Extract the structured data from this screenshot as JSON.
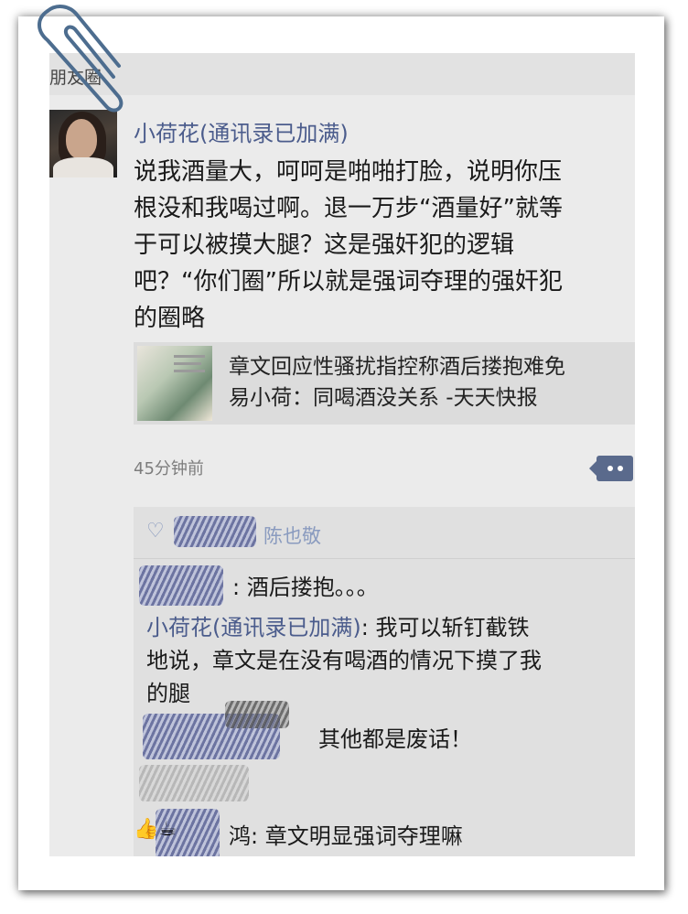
{
  "header": {
    "title": "朋友圈"
  },
  "post": {
    "author": "小荷花(通讯录已加满)",
    "text_lines": [
      "说我酒量大，呵呵是啪啪打脸，说明你压",
      "根没和我喝过啊。退一万步“酒量好”就等",
      "于可以被摸大腿？这是强奸犯的逻辑",
      "吧？“你们圈”所以就是强词夺理的强奸犯",
      "的圈略"
    ],
    "link": {
      "title_lines": [
        "章文回应性骚扰指控称酒后搂抱难免",
        "易小荷：同喝酒没关系 -天天快报"
      ]
    },
    "timestamp": "45分钟前"
  },
  "likes": {
    "names": "陈也敬"
  },
  "comments": [
    {
      "lines": [
        ": 酒后搂抱。。。"
      ]
    },
    {
      "name": "小荷花(通讯录已加满)",
      "lines": [
        ": 我可以斩钉截铁",
        "地说，章文是在没有喝酒的情况下摸了我",
        "的腿"
      ]
    },
    {
      "lines": [
        "其他都是废话！"
      ]
    },
    {
      "lines": [
        "鸿: 章文明显强词夺理嘛"
      ]
    }
  ],
  "reaction": {
    "emoji": "👍☕"
  }
}
